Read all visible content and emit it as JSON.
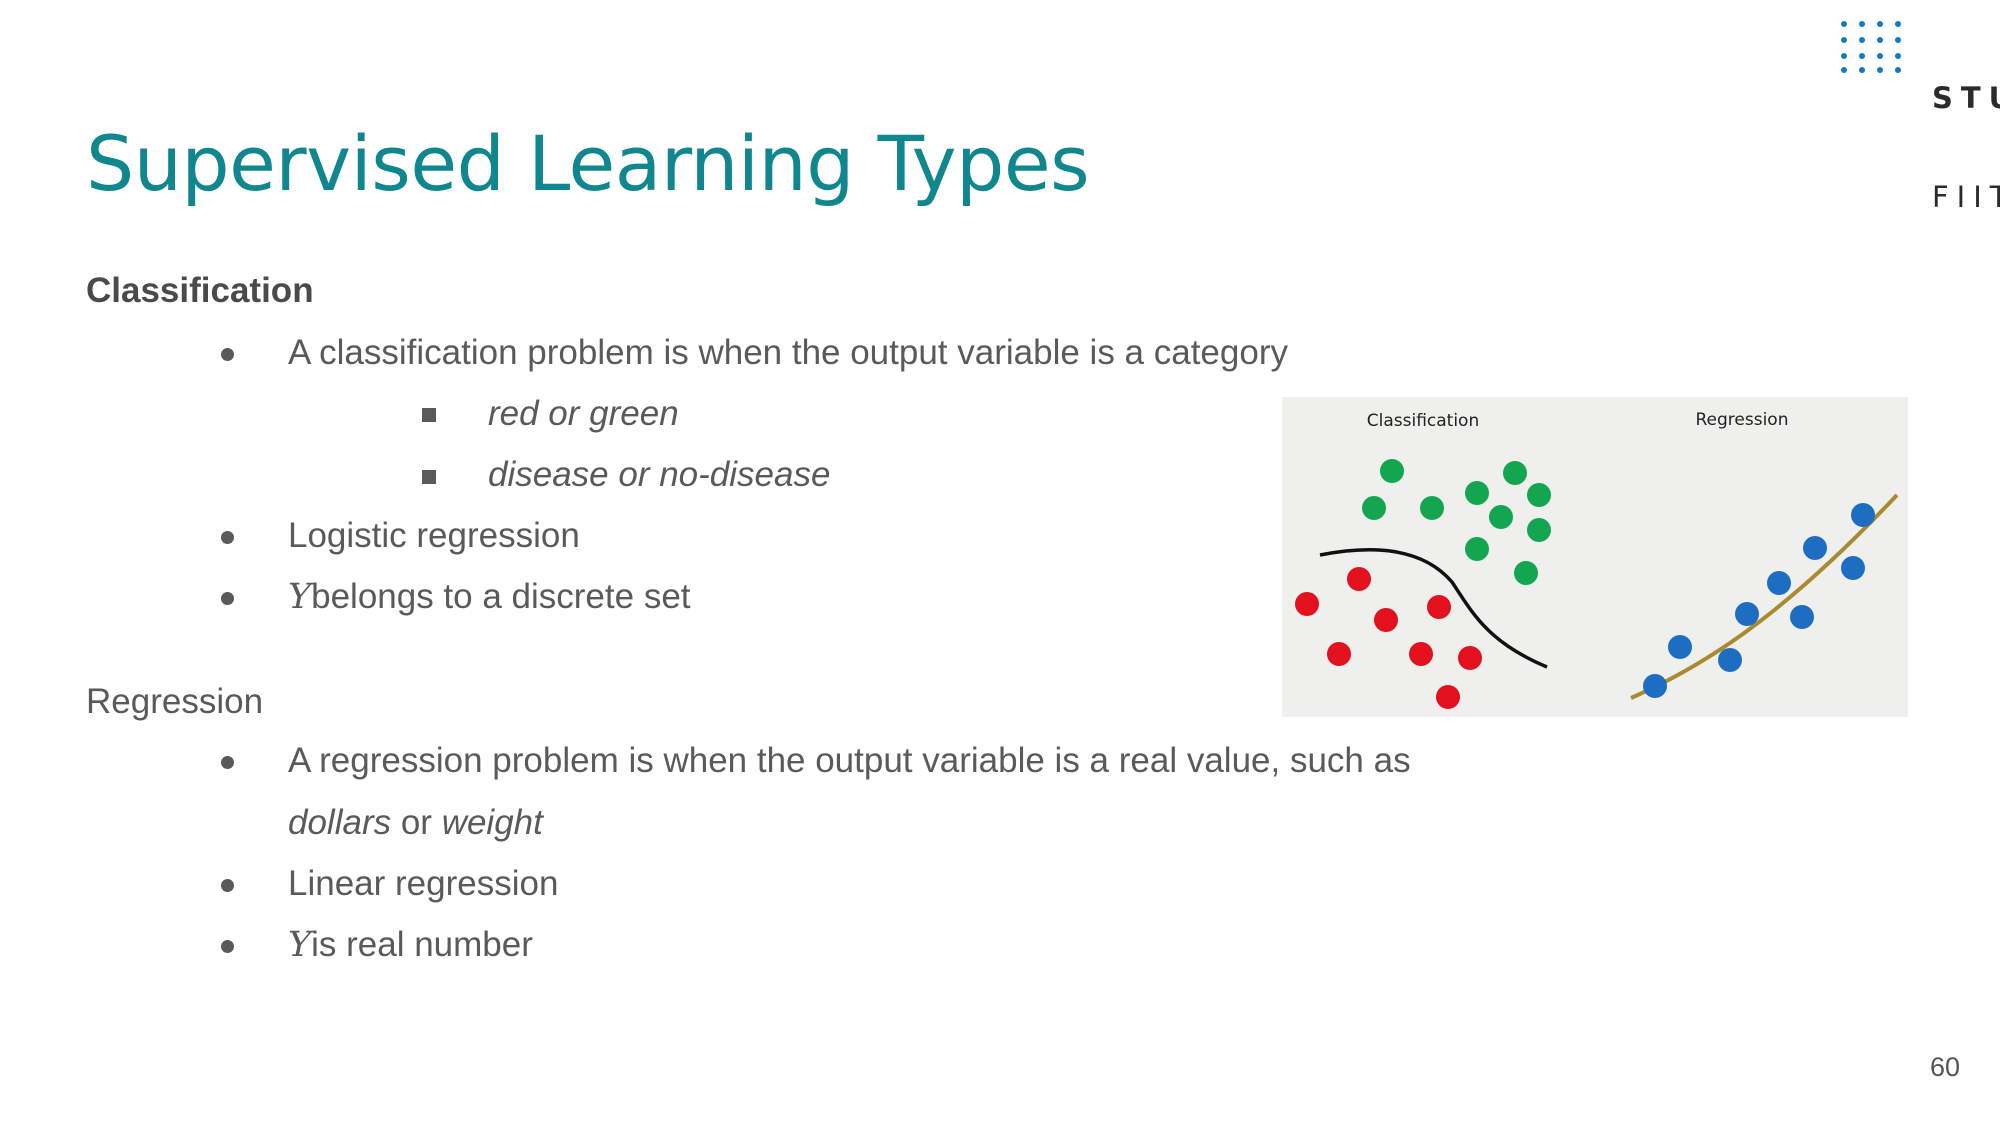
{
  "logo": {
    "line1": "STU",
    "line2": "FIIT"
  },
  "title": "Supervised Learning Types",
  "classification": {
    "heading": "Classification",
    "bullets": [
      "A classification problem is when the output variable is a category",
      "Logistic regression",
      "belongs to a discrete set"
    ],
    "examples": [
      "red or green",
      "disease or no-disease"
    ],
    "y_symbol": "Y"
  },
  "regression": {
    "heading": "Regression",
    "bullet1_line1": "A regression problem is when the output variable is a real value, such as",
    "bullet1_line2": {
      "word1": "dollars",
      "connector": " or ",
      "word2": "weight"
    },
    "bullet2": "Linear regression",
    "bullet3": "is real number",
    "y_symbol": "Y"
  },
  "figure": {
    "left_label": "Classification",
    "right_label": "Regression",
    "colors": {
      "green": "#14a550",
      "red": "#e3101e",
      "blue": "#1d6ec2",
      "curve_black": "#111111",
      "curve_gold": "#a98a2e",
      "background": "#efefed"
    }
  },
  "page_number": "60"
}
